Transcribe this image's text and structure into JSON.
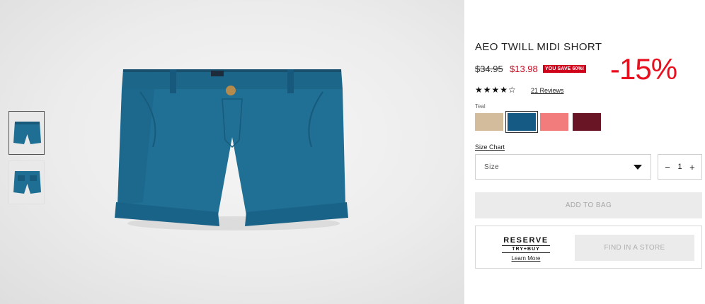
{
  "product": {
    "title": "AEO TWILL MIDI SHORT",
    "old_price": "$34.95",
    "new_price": "$13.98",
    "save_badge": "YOU SAVE 60%!",
    "discount_overlay": "-15%",
    "rating": 4,
    "rating_max": 5,
    "stars_text": "★★★★☆",
    "reviews_link": "21 Reviews",
    "product_color": "#1f6f94"
  },
  "color": {
    "selected_label": "Teal",
    "swatches": [
      {
        "name": "Khaki",
        "hex": "#d2bc9b",
        "selected": false
      },
      {
        "name": "Teal",
        "hex": "#145a85",
        "selected": true
      },
      {
        "name": "Coral",
        "hex": "#f27b7b",
        "selected": false
      },
      {
        "name": "Burgundy",
        "hex": "#6a1526",
        "selected": false
      }
    ]
  },
  "size": {
    "chart_link": "Size Chart",
    "placeholder": "Size"
  },
  "quantity": {
    "minus": "−",
    "value": "1",
    "plus": "+"
  },
  "actions": {
    "add_to_bag": "ADD TO BAG",
    "find_in_store": "FIND IN A STORE"
  },
  "reserve": {
    "logo_top": "RESERVE",
    "logo_bottom": "TRY+BUY",
    "learn_more": "Learn More"
  },
  "icons": {
    "caret": "chevron-down-icon"
  }
}
